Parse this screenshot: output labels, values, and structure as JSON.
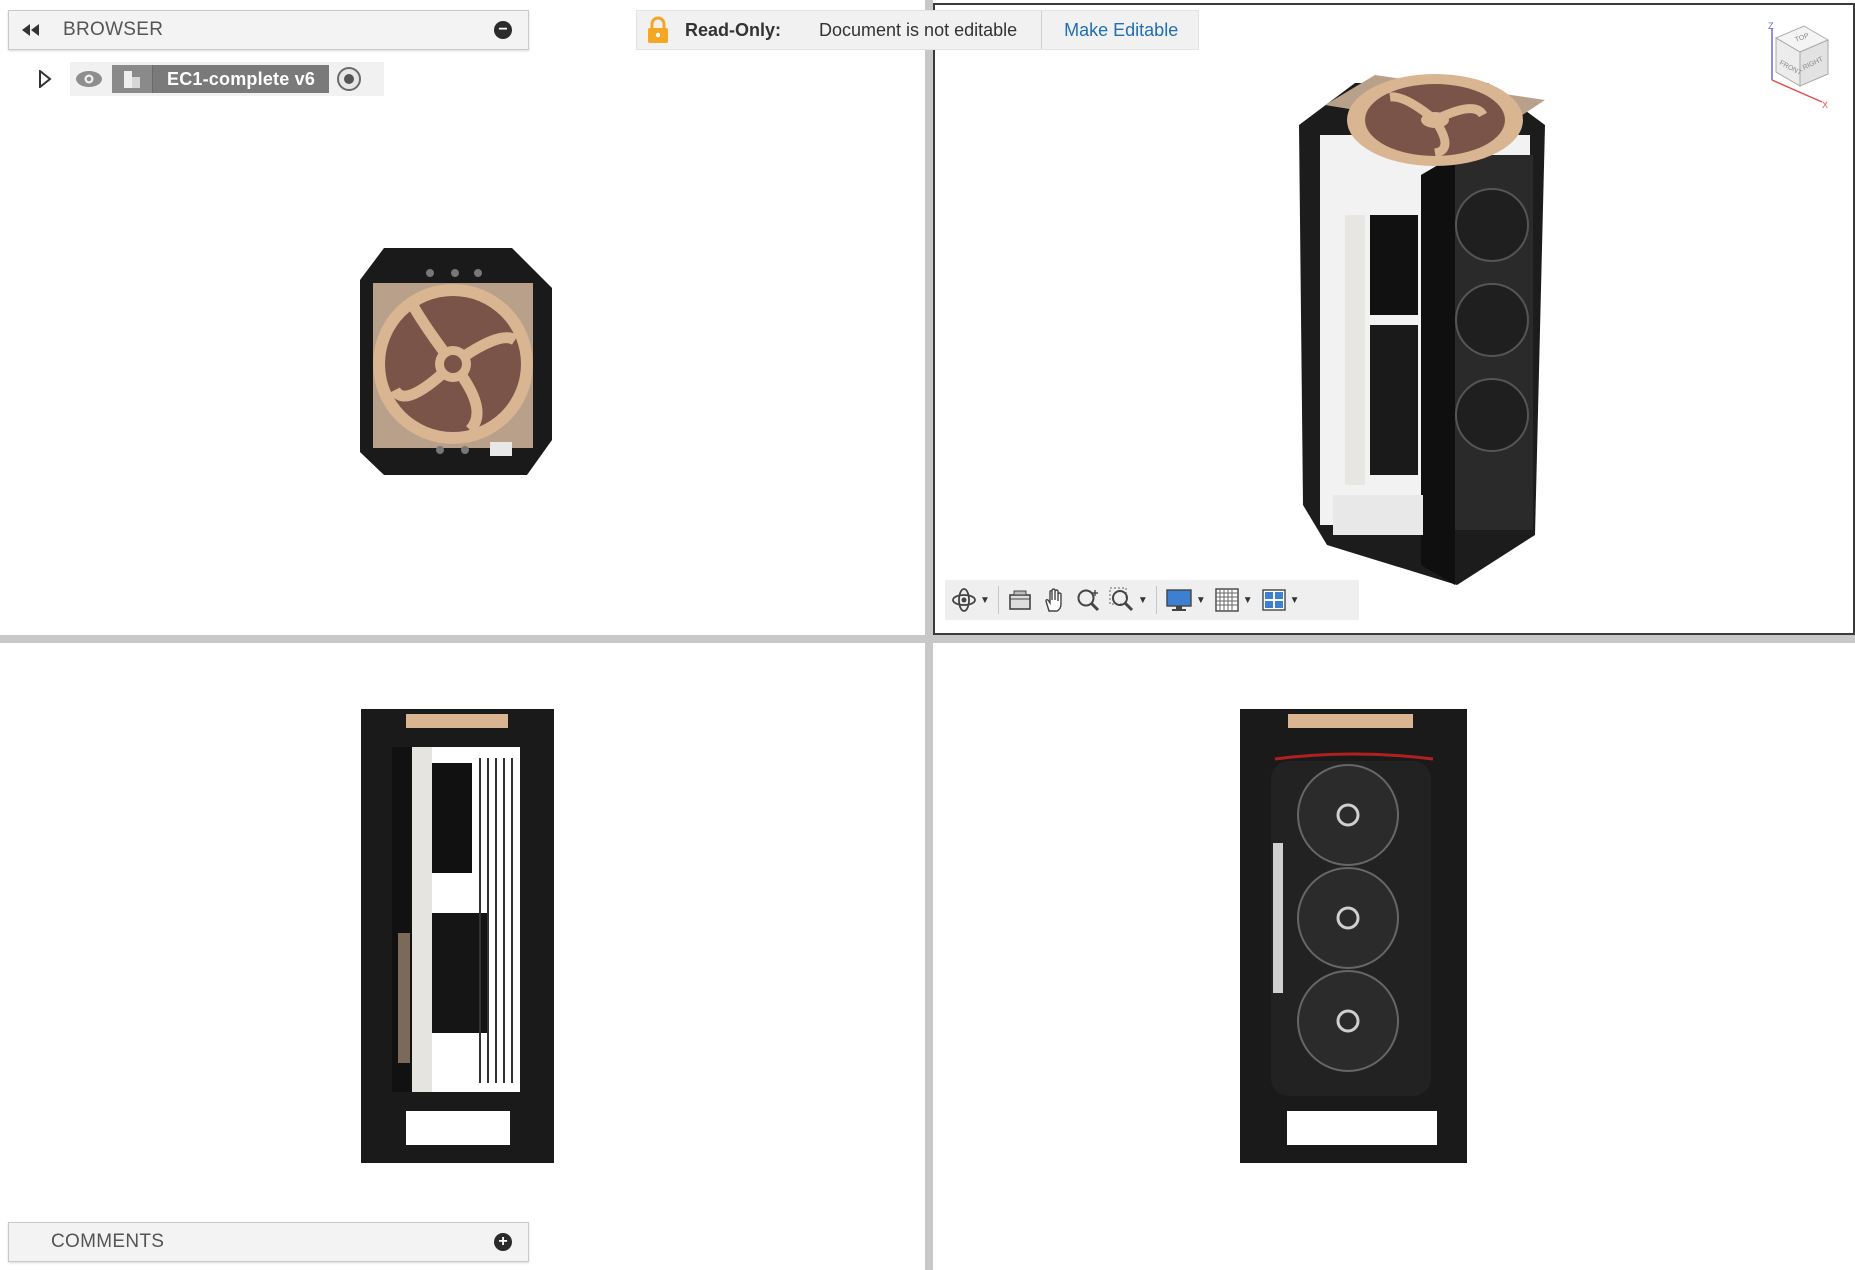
{
  "browser": {
    "title": "BROWSER",
    "document": {
      "name": "EC1-complete v6"
    }
  },
  "comments": {
    "title": "COMMENTS"
  },
  "readonly_bar": {
    "label": "Read-Only:",
    "message": "Document is not editable",
    "action": "Make Editable"
  },
  "viewcube": {
    "top": "TOP",
    "front": "FRONT",
    "right": "RIGHT",
    "x": "X",
    "z": "Z"
  },
  "viewports": [
    "top",
    "perspective",
    "front",
    "right"
  ],
  "nav_toolbar": {
    "tools": [
      "orbit-icon",
      "look-at-icon",
      "pan-icon",
      "zoom-icon",
      "zoom-window-icon",
      "display-settings-icon",
      "grid-icon",
      "viewports-icon"
    ]
  },
  "colors": {
    "accent_link": "#1f6fb5",
    "lock": "#f5a623",
    "fan_beige": "#d9b592",
    "fan_brown": "#7b5449",
    "case_black": "#1a1a1a"
  }
}
